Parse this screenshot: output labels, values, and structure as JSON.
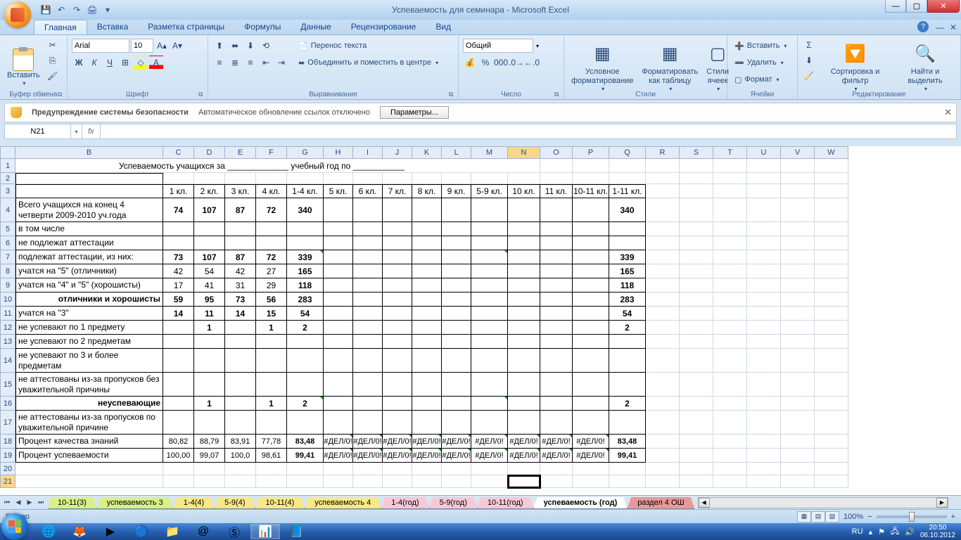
{
  "window": {
    "title": "Успеваемость для семинара - Microsoft Excel"
  },
  "tabs": {
    "home": "Главная",
    "insert": "Вставка",
    "layout": "Разметка страницы",
    "formulas": "Формулы",
    "data": "Данные",
    "review": "Рецензирование",
    "view": "Вид"
  },
  "ribbon": {
    "clipboard": {
      "label": "Буфер обмена",
      "paste": "Вставить"
    },
    "font": {
      "label": "Шрифт",
      "name": "Arial",
      "size": "10"
    },
    "align": {
      "label": "Выравнивание",
      "wrap": "Перенос текста",
      "merge": "Объединить и поместить в центре"
    },
    "number": {
      "label": "Число",
      "fmt": "Общий"
    },
    "styles": {
      "label": "Стили",
      "cond": "Условное форматирование",
      "table": "Форматировать как таблицу",
      "cell": "Стили ячеек"
    },
    "cells": {
      "label": "Ячейки",
      "insert": "Вставить",
      "delete": "Удалить",
      "format": "Формат"
    },
    "editing": {
      "label": "Редактирование",
      "sort": "Сортировка и фильтр",
      "find": "Найти и выделить"
    }
  },
  "security": {
    "title": "Предупреждение системы безопасности",
    "msg": "Автоматическое обновление ссылок отключено",
    "btn": "Параметры..."
  },
  "namebox": "N21",
  "cols": [
    "B",
    "C",
    "D",
    "E",
    "F",
    "G",
    "H",
    "I",
    "J",
    "K",
    "L",
    "M",
    "N",
    "O",
    "P",
    "Q",
    "R",
    "S",
    "T",
    "U",
    "V",
    "W"
  ],
  "sheet": {
    "title": "Успеваемость учащихся за _____________ учебный год по ___________",
    "headers": [
      "1 кл.",
      "2 кл.",
      "3 кл.",
      "4 кл.",
      "1-4 кл.",
      "5 кл.",
      "6 кл.",
      "7 кл.",
      "8 кл.",
      "9 кл.",
      "5-9 кл.",
      "10 кл.",
      "11 кл.",
      "10-11 кл.",
      "1-11 кл."
    ],
    "rows": [
      {
        "n": 4,
        "lbl": "Всего учащихся на конец 4 четверти 2009-2010 уч.года",
        "v": [
          "74",
          "107",
          "87",
          "72",
          "340",
          "",
          "",
          "",
          "",
          "",
          "",
          "",
          "",
          "",
          "340"
        ],
        "b": true,
        "tall": true
      },
      {
        "n": 5,
        "lbl": "в том числе",
        "v": [
          "",
          "",
          "",
          "",
          "",
          "",
          "",
          "",
          "",
          "",
          "",
          "",
          "",
          "",
          ""
        ]
      },
      {
        "n": 6,
        "lbl": "не подлежат аттестации",
        "v": [
          "",
          "",
          "",
          "",
          "",
          "",
          "",
          "",
          "",
          "",
          "",
          "",
          "",
          "",
          ""
        ]
      },
      {
        "n": 7,
        "lbl": "подлежат аттестации, из них:",
        "v": [
          "73",
          "107",
          "87",
          "72",
          "339",
          "",
          "",
          "",
          "",
          "",
          "",
          "",
          "",
          "",
          "339"
        ],
        "b": true,
        "tri": [
          4,
          10
        ]
      },
      {
        "n": 8,
        "lbl": "учатся на \"5\" (отличники)",
        "v": [
          "42",
          "54",
          "42",
          "27",
          "165",
          "",
          "",
          "",
          "",
          "",
          "",
          "",
          "",
          "",
          "165"
        ]
      },
      {
        "n": 9,
        "lbl": "учатся на \"4\" и \"5\" (хорошисты)",
        "v": [
          "17",
          "41",
          "31",
          "29",
          "118",
          "",
          "",
          "",
          "",
          "",
          "",
          "",
          "",
          "",
          "118"
        ]
      },
      {
        "n": 10,
        "lbl": "отличники и хорошисты",
        "v": [
          "59",
          "95",
          "73",
          "56",
          "283",
          "",
          "",
          "",
          "",
          "",
          "",
          "",
          "",
          "",
          "283"
        ],
        "b": true,
        "lb": true
      },
      {
        "n": 11,
        "lbl": "учатся на \"3\"",
        "v": [
          "14",
          "11",
          "14",
          "15",
          "54",
          "",
          "",
          "",
          "",
          "",
          "",
          "",
          "",
          "",
          "54"
        ],
        "b": true
      },
      {
        "n": 12,
        "lbl": "не успевают по 1 предмету",
        "v": [
          "",
          "1",
          "",
          "1",
          "2",
          "",
          "",
          "",
          "",
          "",
          "",
          "",
          "",
          "",
          "2"
        ],
        "b": true
      },
      {
        "n": 13,
        "lbl": "не успевают по 2 предметам",
        "v": [
          "",
          "",
          "",
          "",
          "",
          "",
          "",
          "",
          "",
          "",
          "",
          "",
          "",
          "",
          ""
        ]
      },
      {
        "n": 14,
        "lbl": "не успевают по 3 и более предметам",
        "v": [
          "",
          "",
          "",
          "",
          "",
          "",
          "",
          "",
          "",
          "",
          "",
          "",
          "",
          "",
          ""
        ],
        "tall": true
      },
      {
        "n": 15,
        "lbl": "не аттестованы из-за пропусков без уважительной причины",
        "v": [
          "",
          "",
          "",
          "",
          "",
          "",
          "",
          "",
          "",
          "",
          "",
          "",
          "",
          "",
          ""
        ],
        "tall": true
      },
      {
        "n": 16,
        "lbl": "неуспевающие",
        "v": [
          "",
          "1",
          "",
          "1",
          "2",
          "",
          "",
          "",
          "",
          "",
          "",
          "",
          "",
          "",
          "2"
        ],
        "b": true,
        "lb": true,
        "tri": [
          4,
          10
        ]
      },
      {
        "n": 17,
        "lbl": "не аттестованы из-за пропусков по уважительной причине",
        "v": [
          "",
          "",
          "",
          "",
          "",
          "",
          "",
          "",
          "",
          "",
          "",
          "",
          "",
          "",
          ""
        ],
        "tall": true
      },
      {
        "n": 18,
        "lbl": "Процент качества знаний",
        "v": [
          "80,82",
          "88,79",
          "83,91",
          "77,78",
          "83,48",
          "#ДЕЛ/0!",
          "#ДЕЛ/0!",
          "#ДЕЛ/0!",
          "#ДЕЛ/0!",
          "#ДЕЛ/0!",
          "#ДЕЛ/0!",
          "#ДЕЛ/0!",
          "#ДЕЛ/0!",
          "#ДЕЛ/0!",
          "83,48"
        ],
        "sm": true,
        "tri": [
          5,
          6,
          7,
          8,
          9,
          10,
          11,
          12,
          13
        ]
      },
      {
        "n": 19,
        "lbl": "Процент успеваемости",
        "v": [
          "100,00",
          "99,07",
          "100,0",
          "98,61",
          "99,41",
          "#ДЕЛ/0!",
          "#ДЕЛ/0!",
          "#ДЕЛ/0!",
          "#ДЕЛ/0!",
          "#ДЕЛ/0!",
          "#ДЕЛ/0!",
          "#ДЕЛ/0!",
          "#ДЕЛ/0!",
          "#ДЕЛ/0!",
          "99,41"
        ],
        "sm": true,
        "tri": [
          5,
          6,
          7,
          8,
          9,
          10,
          11,
          12,
          13
        ]
      }
    ]
  },
  "sheets": [
    {
      "name": "10-11(3)",
      "cls": "c1"
    },
    {
      "name": "успеваемость 3",
      "cls": "c1"
    },
    {
      "name": "1-4(4)",
      "cls": "c2"
    },
    {
      "name": "5-9(4)",
      "cls": "c2"
    },
    {
      "name": "10-11(4)",
      "cls": "c2"
    },
    {
      "name": "успеваемость 4",
      "cls": "c2"
    },
    {
      "name": "1-4(год)",
      "cls": "c4"
    },
    {
      "name": "5-9(год)",
      "cls": "c4"
    },
    {
      "name": "10-11(год)",
      "cls": "c4"
    },
    {
      "name": "успеваемость (год)",
      "cls": "active"
    },
    {
      "name": "раздел 4 ОШ",
      "cls": "c5"
    }
  ],
  "status": {
    "ready": "Готово",
    "zoom": "100%"
  },
  "tray": {
    "lang": "RU",
    "time": "20:50",
    "date": "06.10.2012"
  }
}
